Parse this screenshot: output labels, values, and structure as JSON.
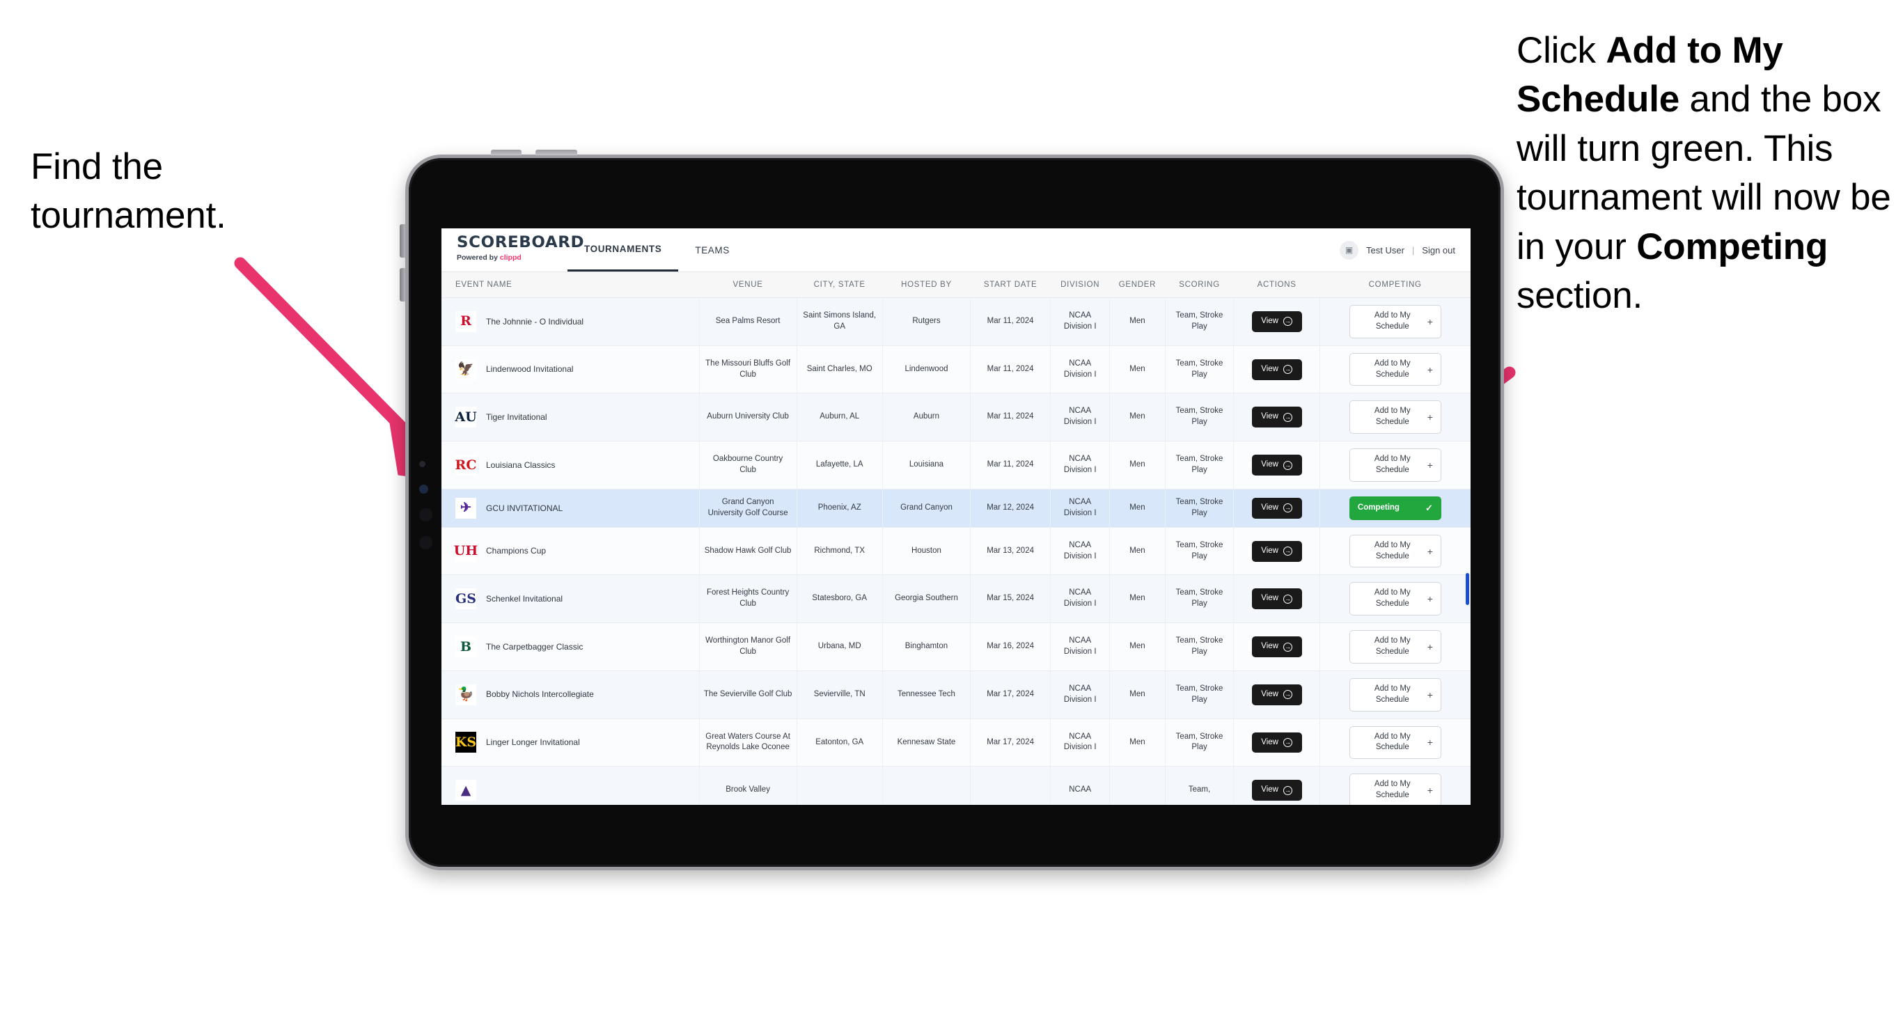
{
  "annotations": {
    "left": {
      "line1": "Find the",
      "line2": "tournament."
    },
    "right": {
      "seg1": "Click ",
      "bold1": "Add to My Schedule",
      "seg2": " and the box will turn green. This tournament will now be in your ",
      "bold2": "Competing",
      "seg3": " section."
    },
    "arrow_color": "#e8336d"
  },
  "app": {
    "brand": {
      "title": "SCOREBOARD",
      "powered_prefix": "Powered by ",
      "powered_brand": "clippd",
      "brand_color": "#f4336d"
    },
    "nav": [
      {
        "label": "TOURNAMENTS",
        "active": true
      },
      {
        "label": "TEAMS",
        "active": false
      }
    ],
    "header_right": {
      "avatar_icon": "user-square-icon",
      "user": "Test User",
      "separator": "|",
      "signout": "Sign out"
    },
    "table": {
      "columns": [
        "EVENT NAME",
        "VENUE",
        "CITY, STATE",
        "HOSTED BY",
        "START DATE",
        "DIVISION",
        "GENDER",
        "SCORING",
        "ACTIONS",
        "COMPETING"
      ],
      "view_label": "View",
      "add_label": "Add to My Schedule",
      "add_icon": "plus-icon",
      "competing_label": "Competing",
      "competing_icon": "check-icon",
      "competing_color": "#22a73f",
      "rows": [
        {
          "logo": "R",
          "logo_color": "#c8102e",
          "logo_bg": "#ffffff",
          "name": "The Johnnie - O Individual",
          "venue": "Sea Palms Resort",
          "city": "Saint Simons Island, GA",
          "host": "Rutgers",
          "date": "Mar 11, 2024",
          "division": "NCAA Division I",
          "gender": "Men",
          "scoring": "Team, Stroke Play",
          "competing": false
        },
        {
          "logo": "🦅",
          "logo_color": "#2b2b2b",
          "logo_bg": "#ffffff",
          "name": "Lindenwood Invitational",
          "venue": "The Missouri Bluffs Golf Club",
          "city": "Saint Charles, MO",
          "host": "Lindenwood",
          "date": "Mar 11, 2024",
          "division": "NCAA Division I",
          "gender": "Men",
          "scoring": "Team, Stroke Play",
          "competing": false
        },
        {
          "logo": "AU",
          "logo_color": "#0c2340",
          "logo_bg": "#ffffff",
          "name": "Tiger Invitational",
          "venue": "Auburn University Club",
          "city": "Auburn, AL",
          "host": "Auburn",
          "date": "Mar 11, 2024",
          "division": "NCAA Division I",
          "gender": "Men",
          "scoring": "Team, Stroke Play",
          "competing": false
        },
        {
          "logo": "RC",
          "logo_color": "#ce181e",
          "logo_bg": "#ffffff",
          "name": "Louisiana Classics",
          "venue": "Oakbourne Country Club",
          "city": "Lafayette, LA",
          "host": "Louisiana",
          "date": "Mar 11, 2024",
          "division": "NCAA Division I",
          "gender": "Men",
          "scoring": "Team, Stroke Play",
          "competing": false
        },
        {
          "logo": "✈",
          "logo_color": "#522398",
          "logo_bg": "#ffffff",
          "name": "GCU INVITATIONAL",
          "venue": "Grand Canyon University Golf Course",
          "city": "Phoenix, AZ",
          "host": "Grand Canyon",
          "date": "Mar 12, 2024",
          "division": "NCAA Division I",
          "gender": "Men",
          "scoring": "Team, Stroke Play",
          "competing": true
        },
        {
          "logo": "UH",
          "logo_color": "#c8102e",
          "logo_bg": "#ffffff",
          "name": "Champions Cup",
          "venue": "Shadow Hawk Golf Club",
          "city": "Richmond, TX",
          "host": "Houston",
          "date": "Mar 13, 2024",
          "division": "NCAA Division I",
          "gender": "Men",
          "scoring": "Team, Stroke Play",
          "competing": false
        },
        {
          "logo": "GS",
          "logo_color": "#27317e",
          "logo_bg": "#ffffff",
          "name": "Schenkel Invitational",
          "venue": "Forest Heights Country Club",
          "city": "Statesboro, GA",
          "host": "Georgia Southern",
          "date": "Mar 15, 2024",
          "division": "NCAA Division I",
          "gender": "Men",
          "scoring": "Team, Stroke Play",
          "competing": false
        },
        {
          "logo": "B",
          "logo_color": "#0e593c",
          "logo_bg": "#ffffff",
          "name": "The Carpetbagger Classic",
          "venue": "Worthington Manor Golf Club",
          "city": "Urbana, MD",
          "host": "Binghamton",
          "date": "Mar 16, 2024",
          "division": "NCAA Division I",
          "gender": "Men",
          "scoring": "Team, Stroke Play",
          "competing": false
        },
        {
          "logo": "🦆",
          "logo_color": "#6a3d9a",
          "logo_bg": "#ffffff",
          "name": "Bobby Nichols Intercollegiate",
          "venue": "The Sevierville Golf Club",
          "city": "Sevierville, TN",
          "host": "Tennessee Tech",
          "date": "Mar 17, 2024",
          "division": "NCAA Division I",
          "gender": "Men",
          "scoring": "Team, Stroke Play",
          "competing": false
        },
        {
          "logo": "KS",
          "logo_color": "#f5c518",
          "logo_bg": "#000000",
          "name": "Linger Longer Invitational",
          "venue": "Great Waters Course At Reynolds Lake Oconee",
          "city": "Eatonton, GA",
          "host": "Kennesaw State",
          "date": "Mar 17, 2024",
          "division": "NCAA Division I",
          "gender": "Men",
          "scoring": "Team, Stroke Play",
          "competing": false
        },
        {
          "logo": "▲",
          "logo_color": "#4b2e83",
          "logo_bg": "#ffffff",
          "name": "",
          "venue": "Brook Valley",
          "city": "",
          "host": "",
          "date": "",
          "division": "NCAA",
          "gender": "",
          "scoring": "Team,",
          "competing": false
        }
      ]
    }
  }
}
